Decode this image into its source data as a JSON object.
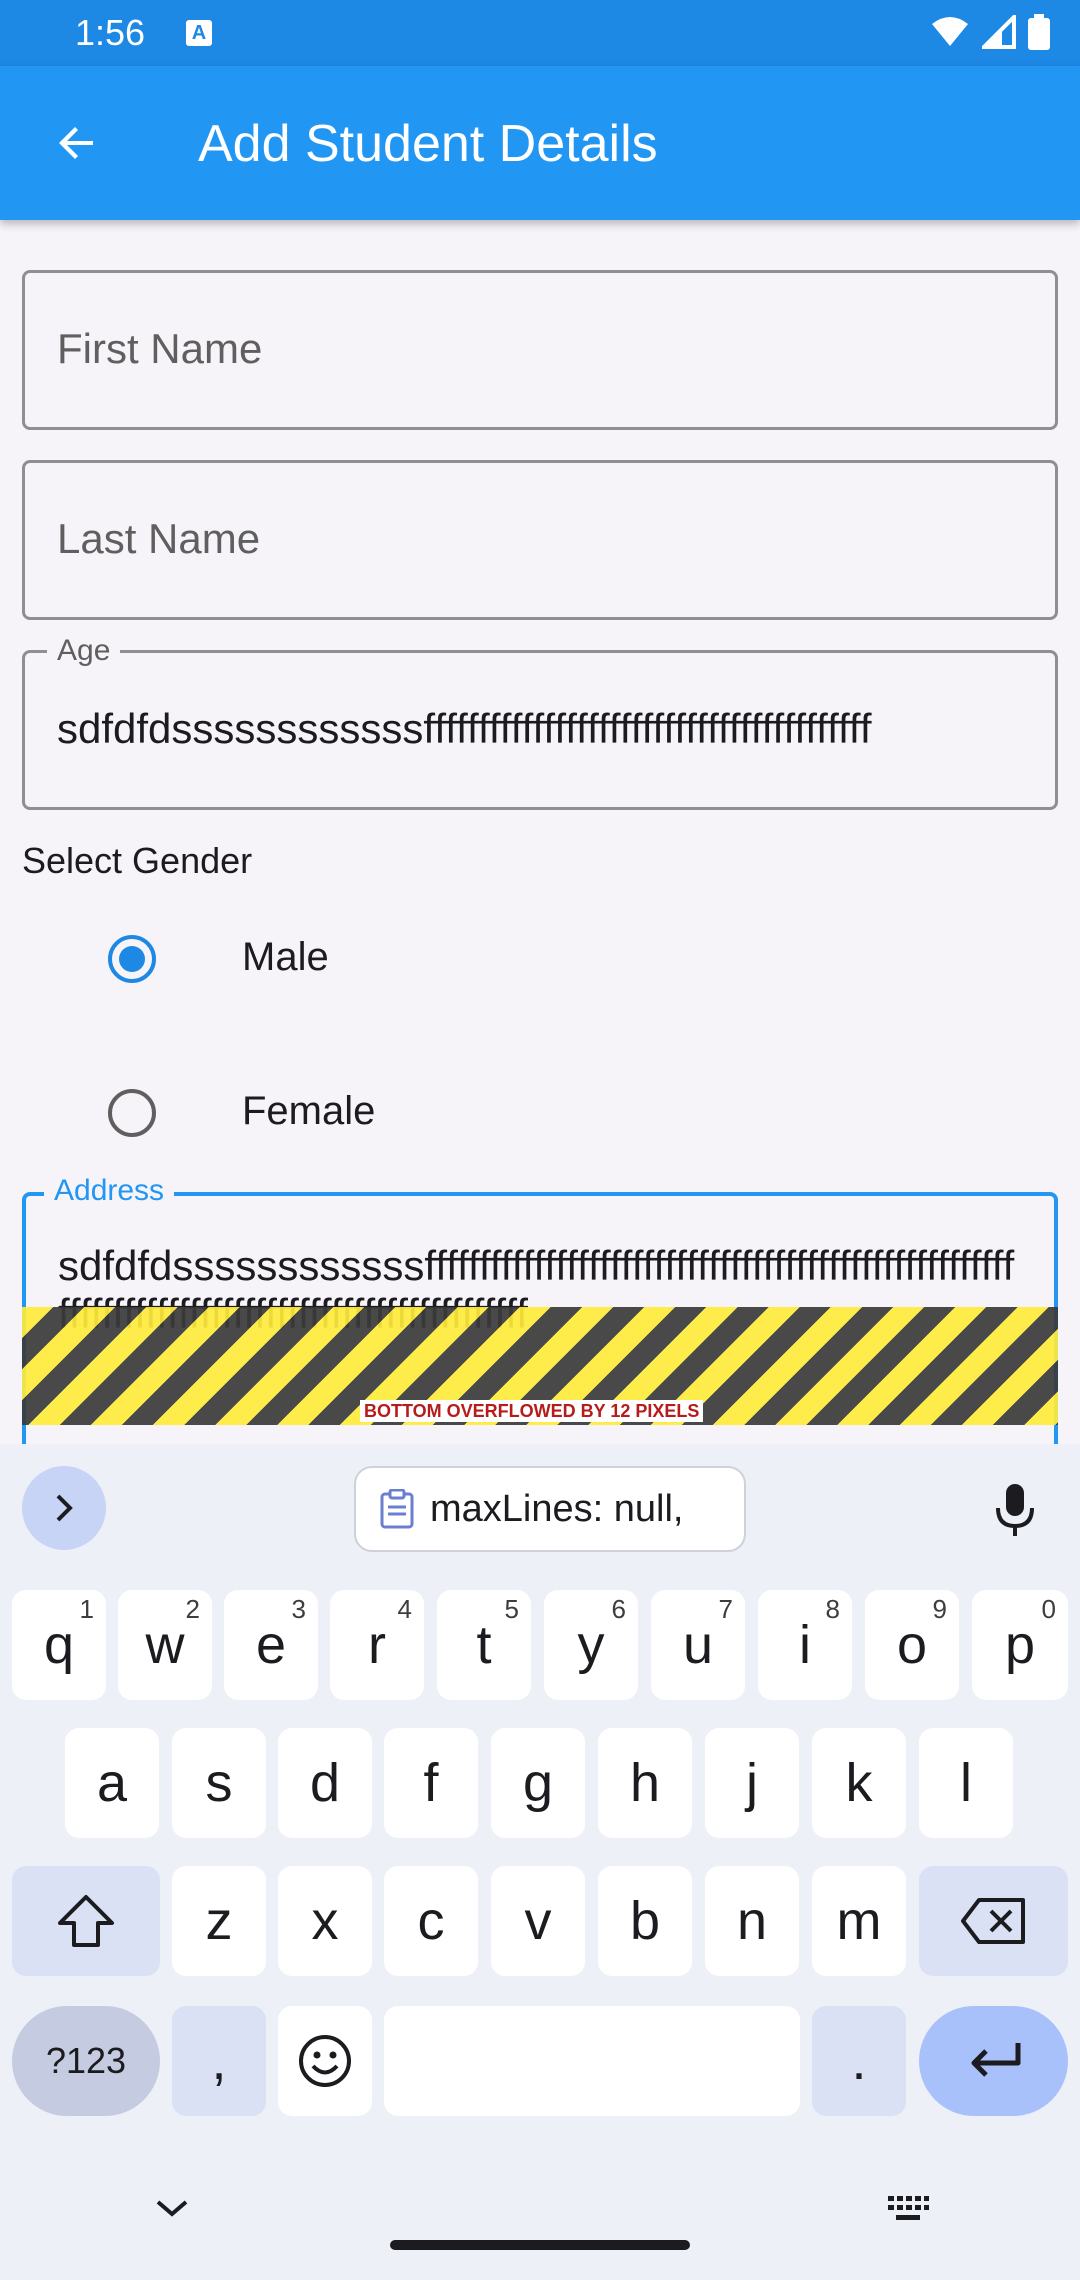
{
  "status_bar": {
    "time": "1:56",
    "app_badge": "A"
  },
  "app_bar": {
    "title": "Add Student Details",
    "back_icon": "arrow-back-icon"
  },
  "form": {
    "first_name": {
      "placeholder": "First Name"
    },
    "last_name": {
      "placeholder": "Last Name"
    },
    "age": {
      "label": "Age",
      "value": "sdfdfdssssssssssssfffffffffffffffffffffffffffffffffffffffff"
    },
    "gender": {
      "label": "Select Gender",
      "options": [
        {
          "label": "Male",
          "selected": true
        },
        {
          "label": "Female",
          "selected": false
        }
      ]
    },
    "address": {
      "label": "Address",
      "value": "sdfdfdssssssssssssfffffffffffffffffffffffffffffffffffffffffffffffffffffffffffffffffffffffffffffffffffffffffffffffff"
    },
    "overflow_warning": "BOTTOM OVERFLOWED BY 12 PIXELS"
  },
  "keyboard": {
    "clipboard_suggestion": "maxLines: null,",
    "row1": [
      {
        "key": "q",
        "hint": "1"
      },
      {
        "key": "w",
        "hint": "2"
      },
      {
        "key": "e",
        "hint": "3"
      },
      {
        "key": "r",
        "hint": "4"
      },
      {
        "key": "t",
        "hint": "5"
      },
      {
        "key": "y",
        "hint": "6"
      },
      {
        "key": "u",
        "hint": "7"
      },
      {
        "key": "i",
        "hint": "8"
      },
      {
        "key": "o",
        "hint": "9"
      },
      {
        "key": "p",
        "hint": "0"
      }
    ],
    "row2": [
      "a",
      "s",
      "d",
      "f",
      "g",
      "h",
      "j",
      "k",
      "l"
    ],
    "row3": [
      "z",
      "x",
      "c",
      "v",
      "b",
      "n",
      "m"
    ],
    "symbols_key": "?123",
    "comma_key": ",",
    "period_key": "."
  }
}
